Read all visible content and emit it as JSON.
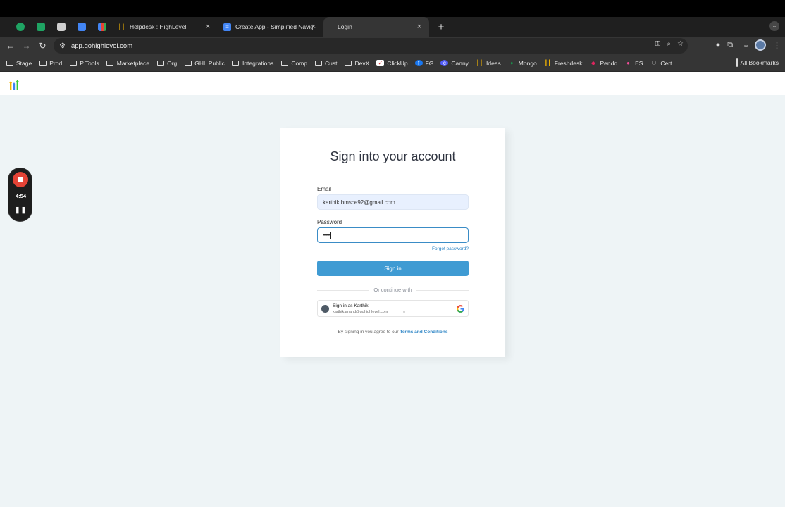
{
  "browser": {
    "pinned_tabs": [
      {
        "icon": "meet-icon",
        "color": "#1fa463"
      },
      {
        "icon": "sheets-icon",
        "color": "#1fa463"
      },
      {
        "icon": "app-icon",
        "color": "#cfcfcf"
      },
      {
        "icon": "calendar-icon",
        "color": "#4285f4"
      },
      {
        "icon": "gmail-icon",
        "color": "#ea4335"
      }
    ],
    "tabs": [
      {
        "title": "Helpdesk : HighLevel",
        "active": false
      },
      {
        "title": "Create App - Simplified Navig",
        "active": false
      },
      {
        "title": "Login",
        "active": true
      }
    ],
    "url": "app.gohighlevel.com",
    "bookmarks": [
      "Stage",
      "Prod",
      "P Tools",
      "Marketplace",
      "Org",
      "GHL Public",
      "Integrations",
      "Comp",
      "Cust",
      "DevX",
      "ClickUp",
      "FG",
      "Canny",
      "Ideas",
      "Mongo",
      "Freshdesk",
      "Pendo",
      "ES",
      "Cert"
    ],
    "all_bookmarks": "All Bookmarks"
  },
  "login": {
    "title": "Sign into your account",
    "email_label": "Email",
    "email_value": "karthik.bmsce92@gmail.com",
    "password_label": "Password",
    "password_value": "•••••••",
    "forgot": "Forgot password?",
    "signin_button": "Sign in",
    "divider": "Or continue with",
    "google_name": "Sign in as Karthik",
    "google_email": "karthik.anand@gohighlevel.com",
    "terms_prefix": "By signing in you agree to our",
    "terms_link": "Terms and Conditions"
  },
  "recorder": {
    "time": "4:54"
  }
}
